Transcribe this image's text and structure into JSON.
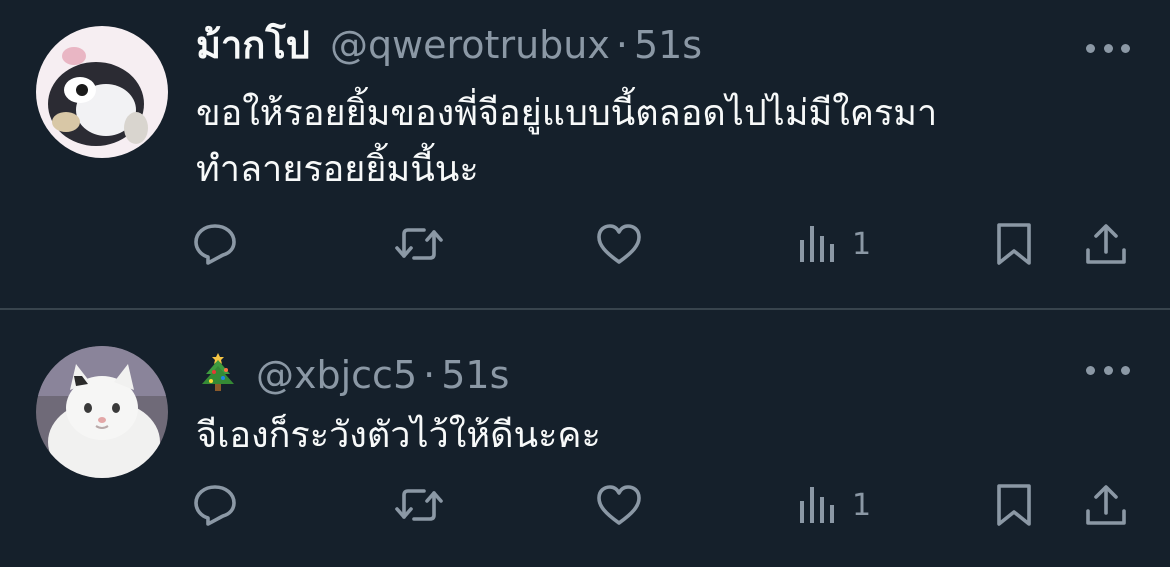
{
  "tweets": [
    {
      "display_name": "ม้ากโป",
      "handle": "@qwerotrubux",
      "separator": "·",
      "time": "51s",
      "text_line1": "ขอให้รอยยิ้มของพี่จีอยู่แบบนี้ตลอดไปไม่มีใครมา",
      "text_line2": "ทำลายรอยยิ้มนี้นะ",
      "avatar_icon": "penguin-plush-avatar",
      "views": "1"
    },
    {
      "display_name": "🎄",
      "handle": "@xbjcc5",
      "separator": "·",
      "time": "51s",
      "text_line1": "จีเองก็ระวังตัวไว้ให้ดีนะคะ",
      "avatar_icon": "white-cat-avatar",
      "views": "1"
    }
  ],
  "icons": {
    "reply": "reply-icon",
    "retweet": "retweet-icon",
    "like": "heart-icon",
    "views": "views-icon",
    "bookmark": "bookmark-icon",
    "share": "share-icon",
    "more": "more-icon"
  },
  "colors": {
    "background": "#15202b",
    "divider": "#38444d",
    "primary_text": "#f7f9f9",
    "secondary_text": "#8b98a5"
  }
}
